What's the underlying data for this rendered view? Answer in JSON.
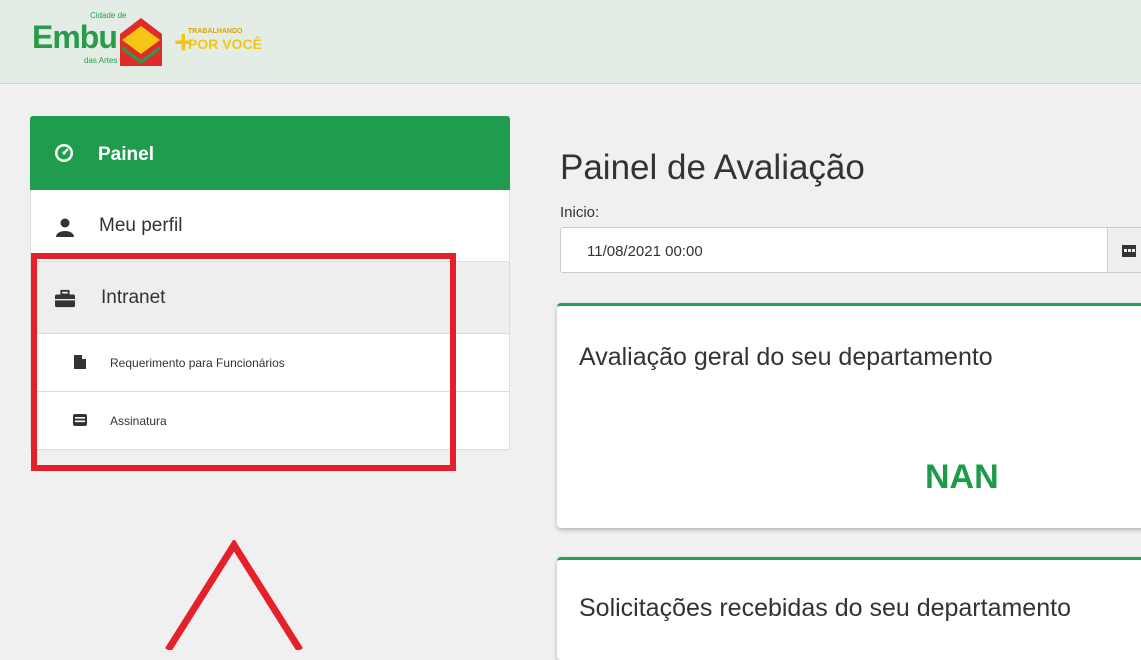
{
  "header": {
    "logo": {
      "cidade": "Cidade de",
      "embu": "Embu",
      "das_artes": "das Artes",
      "plus": "+",
      "trabalhando": "TRABALHANDO",
      "por_voce": "POR VOCÊ"
    }
  },
  "sidebar": {
    "items": [
      {
        "label": "Painel",
        "icon": "dashboard-icon",
        "active": true
      },
      {
        "label": "Meu perfil",
        "icon": "user-icon"
      },
      {
        "label": "Intranet",
        "icon": "briefcase-icon"
      }
    ],
    "subitems": [
      {
        "label": "Requerimento para Funcionários",
        "icon": "file-icon"
      },
      {
        "label": "Assinatura",
        "icon": "signature-icon"
      }
    ]
  },
  "main": {
    "title": "Painel de Avaliação",
    "inicio_label": "Inicio:",
    "inicio_value": "11/08/2021 00:00",
    "cards": [
      {
        "title": "Avaliação geral do seu departamento",
        "value": "NAN"
      },
      {
        "title": "Solicitações recebidas do seu departamento"
      }
    ]
  },
  "colors": {
    "accent_green": "#1f9d4d",
    "highlight_red": "#e6202a",
    "logo_yellow": "#f4c514"
  }
}
